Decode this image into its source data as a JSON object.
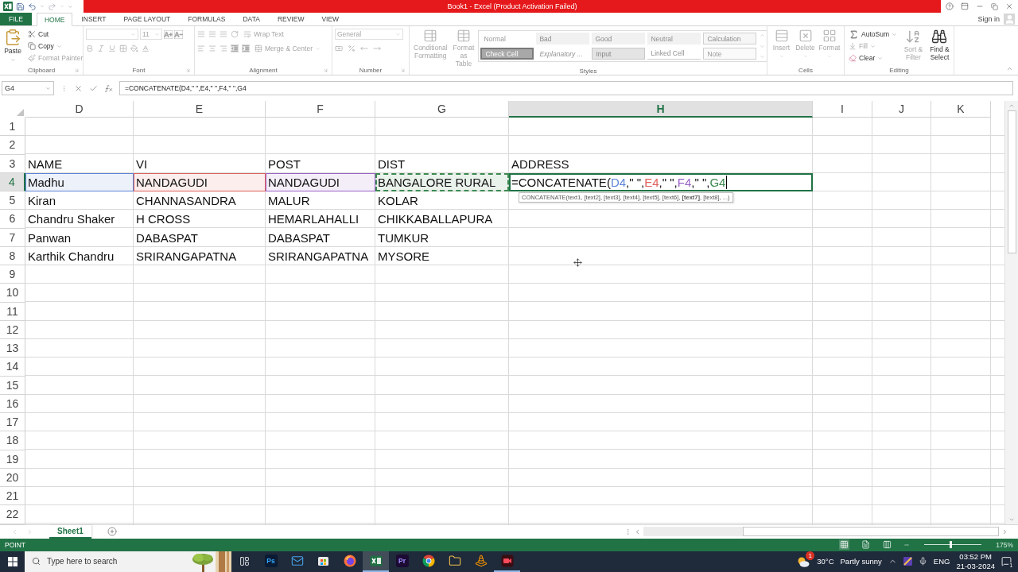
{
  "title_bar": {
    "title": "Book1 -  Excel (Product Activation Failed)"
  },
  "tabs": [
    {
      "label": "FILE",
      "kind": "file",
      "selected": false
    },
    {
      "label": "HOME",
      "kind": "tab",
      "selected": true
    },
    {
      "label": "INSERT",
      "kind": "tab",
      "selected": false
    },
    {
      "label": "PAGE LAYOUT",
      "kind": "tab",
      "selected": false
    },
    {
      "label": "FORMULAS",
      "kind": "tab",
      "selected": false
    },
    {
      "label": "DATA",
      "kind": "tab",
      "selected": false
    },
    {
      "label": "REVIEW",
      "kind": "tab",
      "selected": false
    },
    {
      "label": "VIEW",
      "kind": "tab",
      "selected": false
    }
  ],
  "account": {
    "label": "Sign in"
  },
  "clipboard": {
    "label": "Clipboard",
    "paste": "Paste",
    "commands": [
      {
        "label": "Cut",
        "disabled": false
      },
      {
        "label": "Copy",
        "disabled": false
      },
      {
        "label": "Format Painter",
        "disabled": true
      }
    ]
  },
  "font": {
    "label": "Font",
    "size": "11"
  },
  "alignment": {
    "label": "Alignment",
    "commands": [
      {
        "label": "Wrap Text",
        "disabled": true
      },
      {
        "label": "Merge & Center",
        "disabled": true
      }
    ]
  },
  "number": {
    "label": "Number",
    "format": "General"
  },
  "styles": {
    "label": "Styles",
    "commands": [
      {
        "label": "Conditional Formatting",
        "disabled": true
      },
      {
        "label": "Format as Table",
        "disabled": true
      }
    ],
    "gallery": [
      {
        "label": "Normal",
        "kind": "normal"
      },
      {
        "label": "Bad",
        "kind": "bad"
      },
      {
        "label": "Good",
        "kind": "good"
      },
      {
        "label": "Neutral",
        "kind": "neutral"
      },
      {
        "label": "Calculation",
        "kind": "calculation"
      },
      {
        "label": "Check Cell",
        "kind": "check"
      },
      {
        "label": "Explanatory ...",
        "kind": "explanatory"
      },
      {
        "label": "Input",
        "kind": "input"
      },
      {
        "label": "Linked Cell",
        "kind": "linked"
      },
      {
        "label": "Note",
        "kind": "note"
      }
    ]
  },
  "cells": {
    "label": "Cells",
    "commands": [
      {
        "label": "Insert",
        "disabled": true
      },
      {
        "label": "Delete",
        "disabled": true
      },
      {
        "label": "Format",
        "disabled": true
      }
    ]
  },
  "editing": {
    "label": "Editing",
    "commands": [
      {
        "label": "AutoSum",
        "kind": "autosum",
        "disabled": false
      },
      {
        "label": "Fill",
        "kind": "fill",
        "disabled": true
      },
      {
        "label": "Clear",
        "kind": "clear",
        "disabled": false
      },
      {
        "label": "Sort & Filter",
        "kind": "sort",
        "disabled": true
      },
      {
        "label": "Find & Select",
        "kind": "find",
        "disabled": false
      }
    ]
  },
  "formula_bar": {
    "name_box": "G4",
    "formula": "=CONCATENATE(D4,\" \",E4,\" \",F4,\" \",G4"
  },
  "sheet": {
    "columns": [
      {
        "label": "D",
        "selected": false
      },
      {
        "label": "E",
        "selected": false
      },
      {
        "label": "F",
        "selected": false
      },
      {
        "label": "G",
        "selected": false
      },
      {
        "label": "H",
        "selected": true
      },
      {
        "label": "I",
        "selected": false
      },
      {
        "label": "J",
        "selected": false
      },
      {
        "label": "K",
        "selected": false
      }
    ],
    "rows": [
      {
        "label": "1",
        "selected": false
      },
      {
        "label": "2",
        "selected": false
      },
      {
        "label": "3",
        "selected": false,
        "cells": [
          {
            "value": "NAME"
          },
          {
            "value": "VI"
          },
          {
            "value": "POST"
          },
          {
            "value": "DIST"
          },
          {
            "value": "ADDRESS"
          }
        ]
      },
      {
        "label": "4",
        "selected": true,
        "cells": [
          {
            "kind": "reference",
            "value": "Madhu",
            "color": "#5b84d6",
            "pointing": false
          },
          {
            "kind": "reference",
            "value": "NANDAGUDI",
            "color": "#e0605a",
            "pointing": false
          },
          {
            "kind": "reference",
            "value": "NANDAGUDI",
            "color": "#9a62c8",
            "pointing": false
          },
          {
            "kind": "reference",
            "value": "BANGALORE RURAL",
            "color": "#3d8a4f",
            "pointing": true
          },
          {
            "kind": "editing",
            "segments": [
              {
                "text": "=CONCATENATE("
              },
              {
                "text": "D4",
                "color": "#5b84d6"
              },
              {
                "text": ",\" \","
              },
              {
                "text": "E4",
                "color": "#e0605a"
              },
              {
                "text": ",\" \","
              },
              {
                "text": "F4",
                "color": "#9a62c8"
              },
              {
                "text": ",\" \","
              },
              {
                "text": "G4",
                "color": "#3d8a4f"
              }
            ],
            "tooltip": "CONCATENATE(text1, [text2], [text3], [text4], [text5], [text6], **[text7]**, [text8], ...)"
          }
        ]
      },
      {
        "label": "5",
        "selected": false,
        "cells": [
          {
            "value": "Kiran"
          },
          {
            "value": "CHANNASANDRA"
          },
          {
            "value": "MALUR"
          },
          {
            "value": "KOLAR"
          }
        ]
      },
      {
        "label": "6",
        "selected": false,
        "cells": [
          {
            "value": "Chandru Shaker"
          },
          {
            "value": "H CROSS"
          },
          {
            "value": "HEMARLAHALLI"
          },
          {
            "value": "CHIKKABALLAPURA"
          }
        ]
      },
      {
        "label": "7",
        "selected": false,
        "cells": [
          {
            "value": "Panwan"
          },
          {
            "value": "DABASPAT"
          },
          {
            "value": "DABASPAT"
          },
          {
            "value": "TUMKUR"
          }
        ]
      },
      {
        "label": "8",
        "selected": false,
        "cells": [
          {
            "value": "Karthik Chandru"
          },
          {
            "value": "SRIRANGAPATNA"
          },
          {
            "value": "SRIRANGAPATNA"
          },
          {
            "value": "MYSORE"
          }
        ]
      },
      {
        "label": "9",
        "selected": false
      },
      {
        "label": "10",
        "selected": false
      },
      {
        "label": "11",
        "selected": false
      },
      {
        "label": "12",
        "selected": false
      },
      {
        "label": "13",
        "selected": false
      },
      {
        "label": "14",
        "selected": false
      },
      {
        "label": "15",
        "selected": false
      },
      {
        "label": "16",
        "selected": false
      },
      {
        "label": "17",
        "selected": false
      },
      {
        "label": "18",
        "selected": false
      },
      {
        "label": "19",
        "selected": false
      },
      {
        "label": "20",
        "selected": false
      },
      {
        "label": "21",
        "selected": false
      },
      {
        "label": "22",
        "selected": false
      }
    ]
  },
  "sheet_tabs": [
    {
      "label": "Sheet1",
      "selected": true
    }
  ],
  "status_bar": {
    "mode": "POINT",
    "views": [
      {
        "kind": "normal",
        "selected": true
      },
      {
        "kind": "page_layout",
        "selected": false
      },
      {
        "kind": "page_break",
        "selected": false
      }
    ],
    "zoom_slider": {
      "level": 0.46
    },
    "zoom": "175%"
  },
  "taskbar": {
    "search": {
      "placeholder": "Type here to search"
    },
    "apps": [
      {
        "kind": "ps",
        "label": "Ps",
        "active": false,
        "running": false
      },
      {
        "kind": "mail",
        "active": false,
        "running": false
      },
      {
        "kind": "store",
        "active": false,
        "running": false
      },
      {
        "kind": "firefox",
        "active": false,
        "running": false
      },
      {
        "kind": "excel",
        "active": true,
        "running": true
      },
      {
        "kind": "pr",
        "label": "Pr",
        "active": false,
        "running": false
      },
      {
        "kind": "chrome",
        "active": false,
        "running": false
      },
      {
        "kind": "files",
        "active": false,
        "running": false
      },
      {
        "kind": "vlc",
        "active": false,
        "running": false
      },
      {
        "kind": "recorder",
        "active": false,
        "running": true
      }
    ],
    "weather": {
      "badge": "1",
      "temperature": "30°C",
      "condition": "Partly sunny"
    },
    "language": "ENG",
    "time": "03:52 PM",
    "date": "21-03-2024",
    "notifications": "1"
  }
}
